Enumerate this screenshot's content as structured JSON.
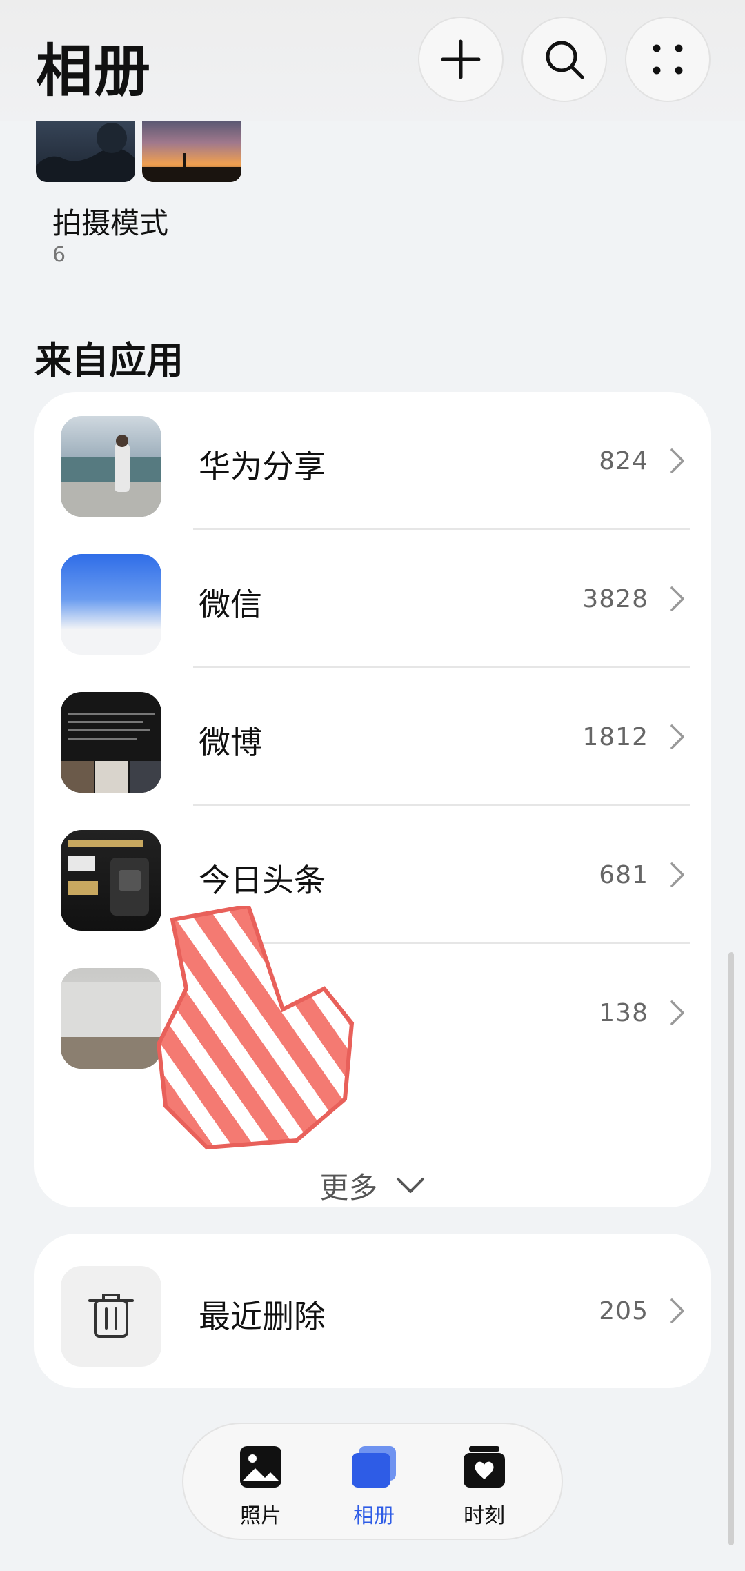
{
  "header": {
    "title": "相册",
    "buttons": {
      "add": "add-icon",
      "search": "search-icon",
      "more": "more-dots-icon"
    }
  },
  "shooting_mode": {
    "title": "拍摄模式",
    "count": "6"
  },
  "from_apps": {
    "title": "来自应用",
    "items": [
      {
        "name": "华为分享",
        "count": "824"
      },
      {
        "name": "微信",
        "count": "3828"
      },
      {
        "name": "微博",
        "count": "1812"
      },
      {
        "name": "今日头条",
        "count": "681"
      },
      {
        "name": "",
        "count": "138"
      }
    ],
    "more_label": "更多"
  },
  "recently_deleted": {
    "name": "最近删除",
    "count": "205",
    "icon": "trash-icon"
  },
  "bottom_nav": {
    "items": [
      {
        "label": "照片",
        "icon": "photo-icon"
      },
      {
        "label": "相册",
        "icon": "album-icon",
        "active": true
      },
      {
        "label": "时刻",
        "icon": "moments-icon"
      }
    ]
  },
  "colors": {
    "accent": "#2e5ce6",
    "background": "#f1f3f5",
    "card": "#ffffff"
  }
}
